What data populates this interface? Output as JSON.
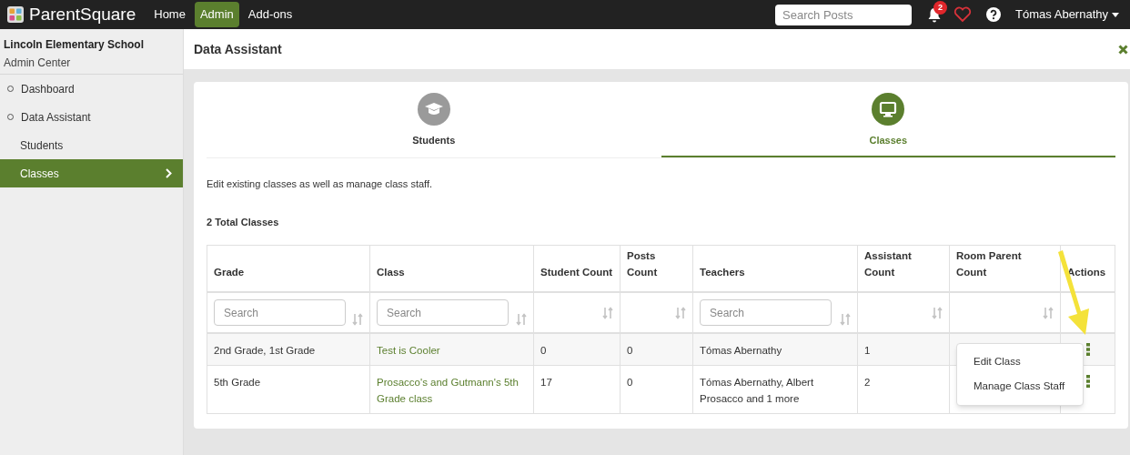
{
  "topbar": {
    "logo": "ParentSquare",
    "nav": [
      {
        "label": "Home",
        "selected": false
      },
      {
        "label": "Admin",
        "selected": true
      },
      {
        "label": "Add-ons",
        "selected": false
      }
    ],
    "search": {
      "placeholder": "Search Posts"
    },
    "notifications": "2",
    "user": "Tómas Abernathy"
  },
  "sidebar": {
    "school": "Lincoln Elementary School",
    "subtitle": "Admin Center",
    "items": [
      {
        "label": "Dashboard",
        "selected": false
      },
      {
        "label": "Data Assistant",
        "selected": false,
        "children": [
          {
            "label": "Students",
            "selected": false
          },
          {
            "label": "Classes",
            "selected": true
          }
        ]
      }
    ]
  },
  "panel": {
    "title": "Data Assistant",
    "tabs": [
      {
        "label": "Students",
        "selected": false,
        "kind": "students"
      },
      {
        "label": "Classes",
        "selected": true,
        "kind": "classes"
      }
    ],
    "description": "Edit existing classes as well as manage class staff.",
    "total": "2 Total Classes",
    "table": {
      "columns": [
        {
          "label": "Grade",
          "placeholder": "Search",
          "sortable": true
        },
        {
          "label": "Class",
          "placeholder": "Search",
          "sortable": true
        },
        {
          "label": "Student Count",
          "sortable": true
        },
        {
          "label": "Posts Count",
          "sortable": true
        },
        {
          "label": "Teachers",
          "placeholder": "Search",
          "sortable": true
        },
        {
          "label": "Assistant Count",
          "sortable": true
        },
        {
          "label": "Room Parent Count",
          "sortable": true
        },
        {
          "label": "Actions",
          "sortable": false
        }
      ],
      "rows": [
        {
          "grade": "2nd Grade, 1st Grade",
          "class": "Test is Cooler",
          "students": "0",
          "posts": "0",
          "teachers": "Tómas Abernathy",
          "assistants": "1",
          "menu_open": true
        },
        {
          "grade": "5th Grade",
          "class": "Prosacco's and Gutmann's 5th Grade class",
          "students": "17",
          "posts": "0",
          "teachers": "Tómas Abernathy, Albert Prosacco and 1 more",
          "assistants": "2",
          "menu_open": false
        }
      ],
      "menu": [
        "Edit Class",
        "Manage Class Staff"
      ]
    }
  }
}
